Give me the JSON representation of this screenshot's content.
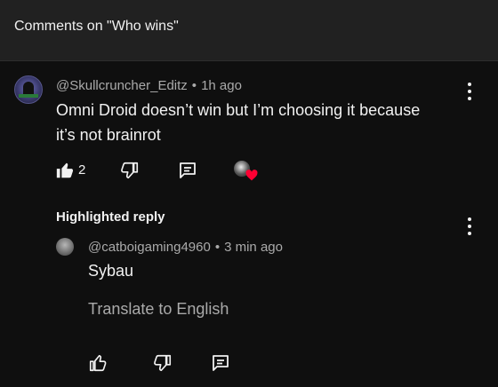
{
  "header": {
    "title": "Comments on \"Who wins\""
  },
  "comment": {
    "author": "@Skullcruncher_Editz",
    "time": "1h ago",
    "text_line1": "Omni Droid doesn’t win but I’m choosing it because",
    "text_line2": "it’s not brainrot",
    "like_count": "2"
  },
  "highlighted": {
    "label": "Highlighted reply",
    "author": "@catboigaming4960",
    "time": "3 min ago",
    "text": "Sybau",
    "translate": "Translate to English"
  },
  "icons": {
    "like": "thumb-up-icon",
    "dislike": "thumb-down-icon",
    "reply": "reply-comment-icon",
    "more": "more-vertical-icon",
    "creator_heart": "creator-heart-icon"
  },
  "colors": {
    "background": "#0f0f0f",
    "header": "#212121",
    "primary_text": "#f1f1f1",
    "secondary_text": "#aaaaaa",
    "heart": "#ff0033"
  }
}
